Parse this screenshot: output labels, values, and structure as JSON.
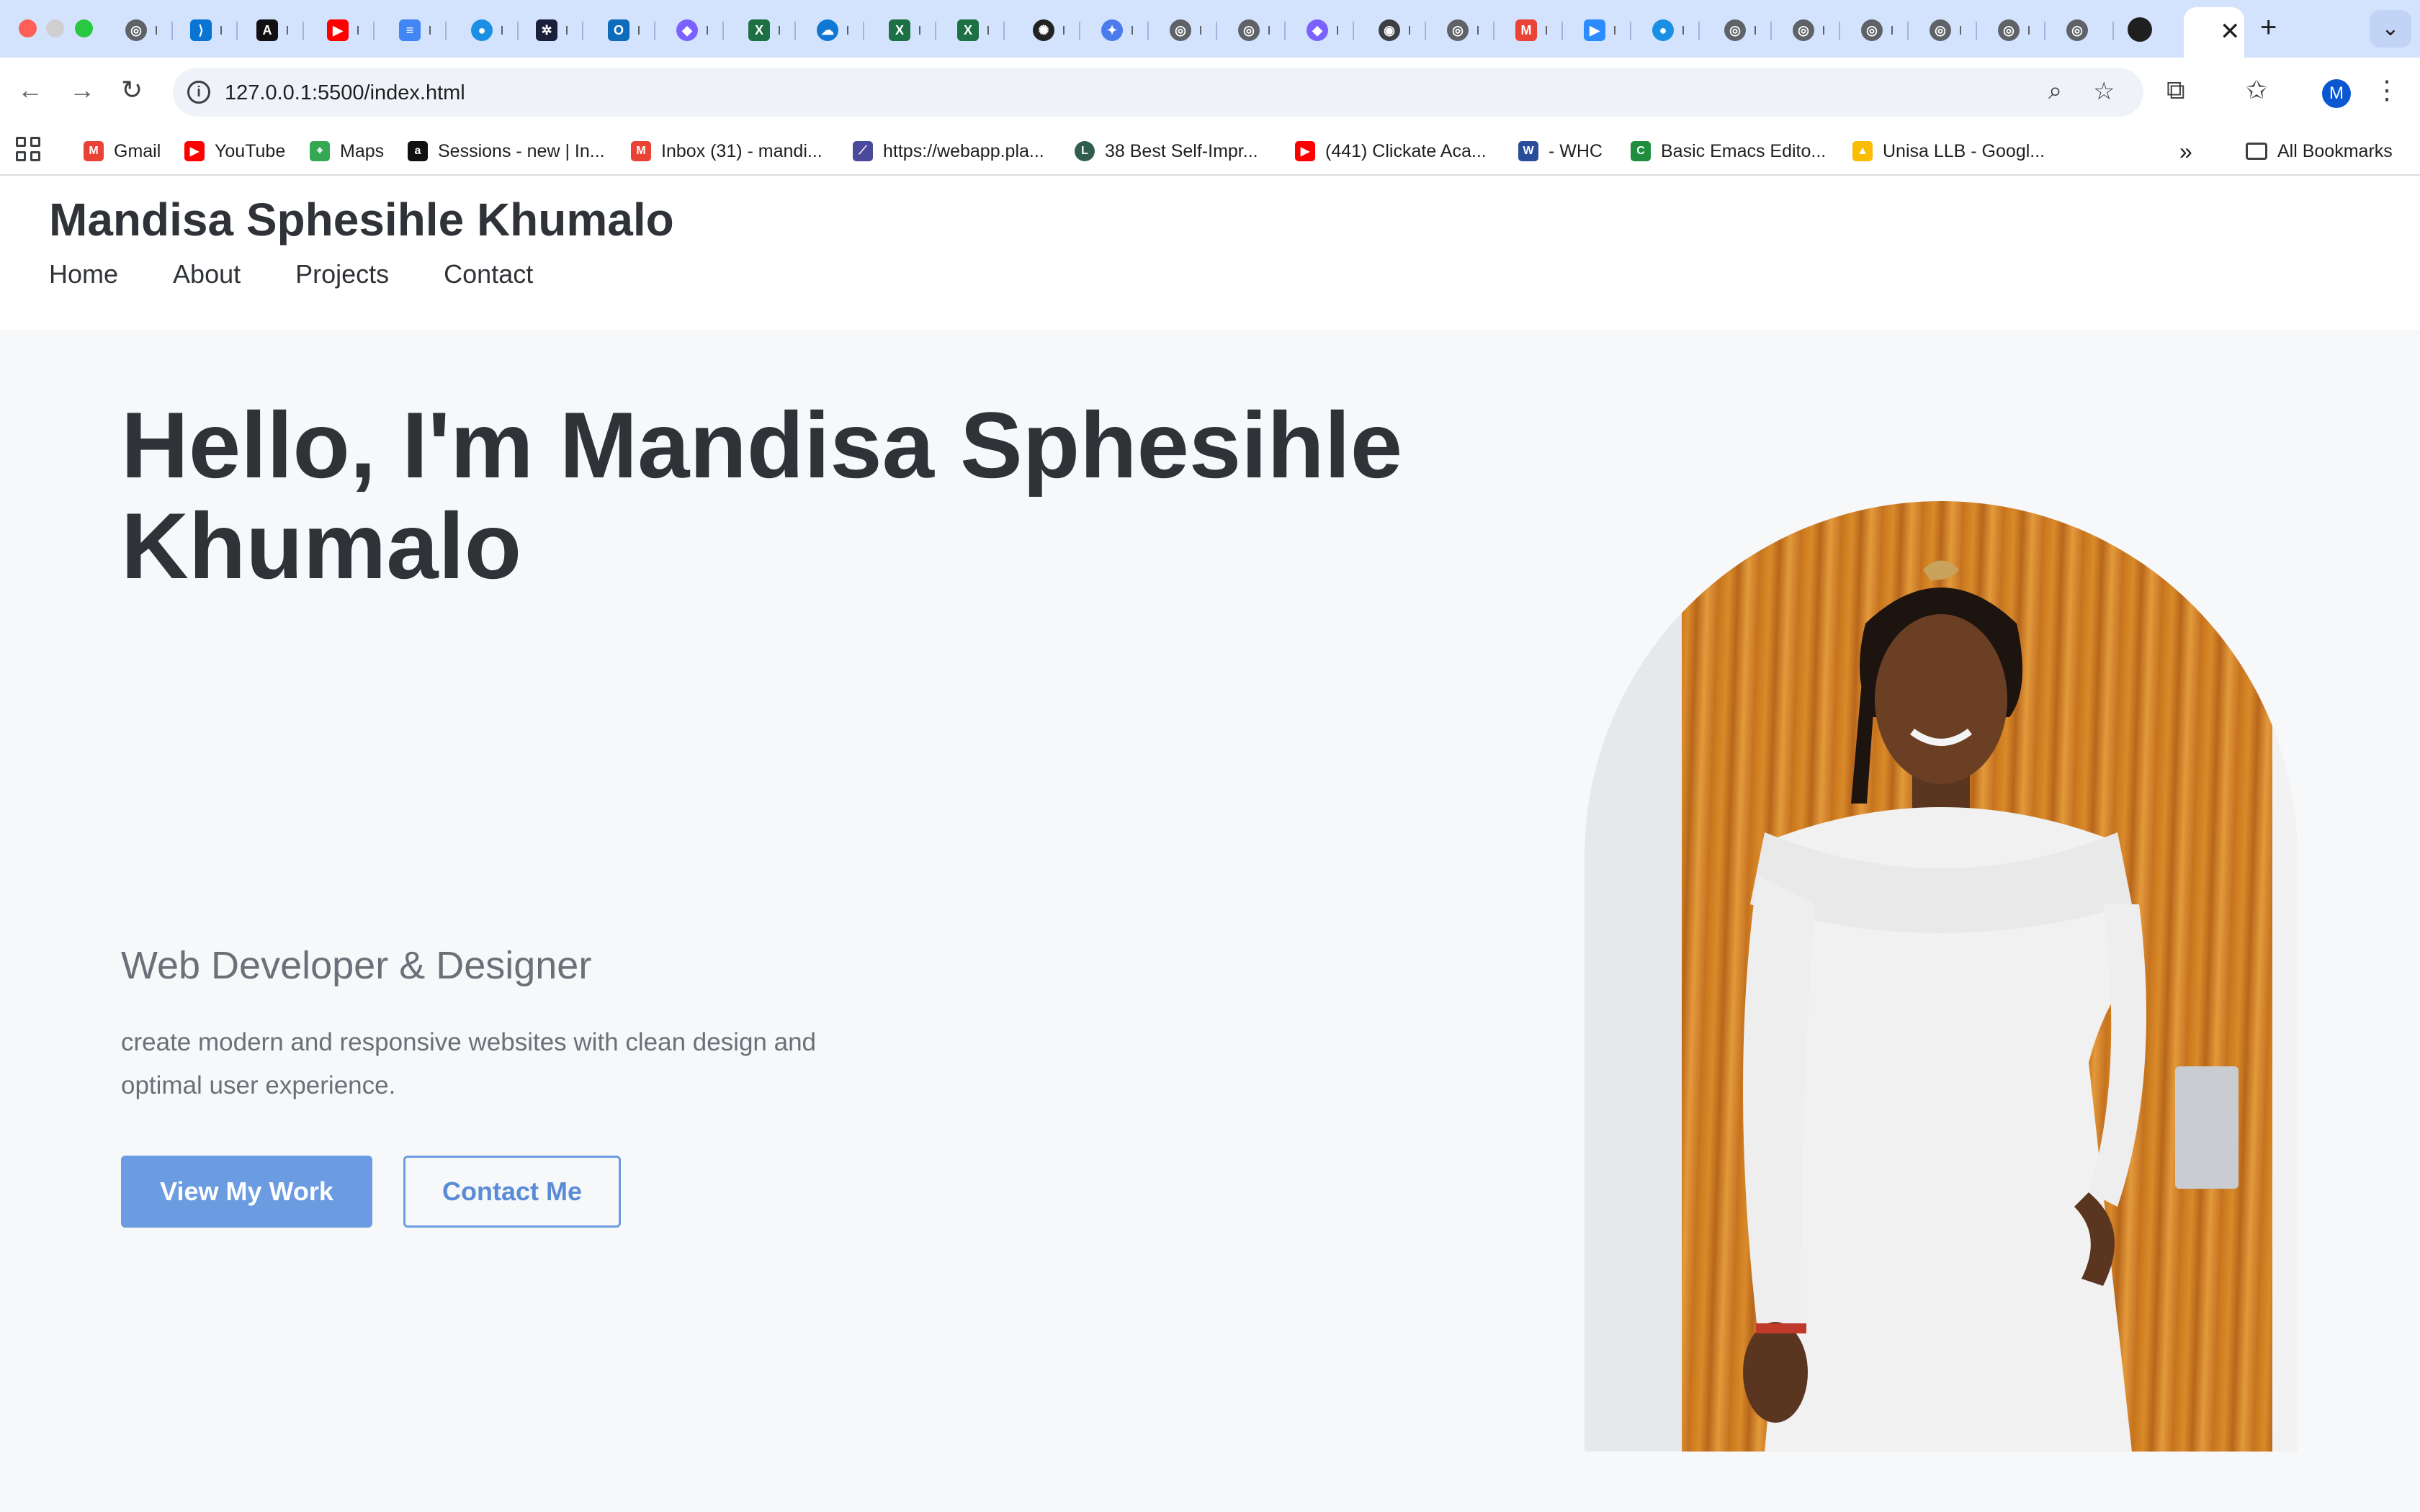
{
  "browser": {
    "url": "127.0.0.1:5500/index.html",
    "avatar_letter": "M",
    "bookmarks": [
      {
        "label": "Gmail",
        "icon": "gmail-icon",
        "color": "#ea4335"
      },
      {
        "label": "YouTube",
        "icon": "youtube-icon",
        "color": "#ff0000"
      },
      {
        "label": "Maps",
        "icon": "maps-icon",
        "color": "#34a853"
      },
      {
        "label": "Sessions - new | In...",
        "icon": "alx-icon",
        "color": "#111111"
      },
      {
        "label": "Inbox (31) - mandi...",
        "icon": "gmail-icon",
        "color": "#ea4335"
      },
      {
        "label": "https://webapp.pla...",
        "icon": "link-icon",
        "color": "#4a4a9c"
      },
      {
        "label": "38 Best Self-Impr...",
        "icon": "lh-icon",
        "color": "#2f5d50"
      },
      {
        "label": "(441) Clickate Aca...",
        "icon": "youtube-icon",
        "color": "#ff0000"
      },
      {
        "label": "- WHC",
        "icon": "whc-icon",
        "color": "#2a4d9b"
      },
      {
        "label": "Basic Emacs Edito...",
        "icon": "cs-icon",
        "color": "#1e8e3e"
      },
      {
        "label": "Unisa LLB - Googl...",
        "icon": "drive-icon",
        "color": "#fbbc04"
      }
    ],
    "all_bookmarks_label": "All Bookmarks",
    "more_bookmarks_glyph": "»"
  },
  "site": {
    "name": "Mandisa Sphesihle Khumalo",
    "nav": [
      "Home",
      "About",
      "Projects",
      "Contact"
    ]
  },
  "hero": {
    "title": "Hello, I'm Mandisa Sphesihle Khumalo",
    "subtitle": "Web Developer & Designer",
    "description": "create modern and responsive websites with clean design and optimal user experience.",
    "primary_button": "View My Work",
    "secondary_button": "Contact Me"
  },
  "colors": {
    "accent": "#6b9be0",
    "heading": "#2f3338",
    "muted_text": "#6b7078",
    "hero_background": "#f7f8fa"
  }
}
